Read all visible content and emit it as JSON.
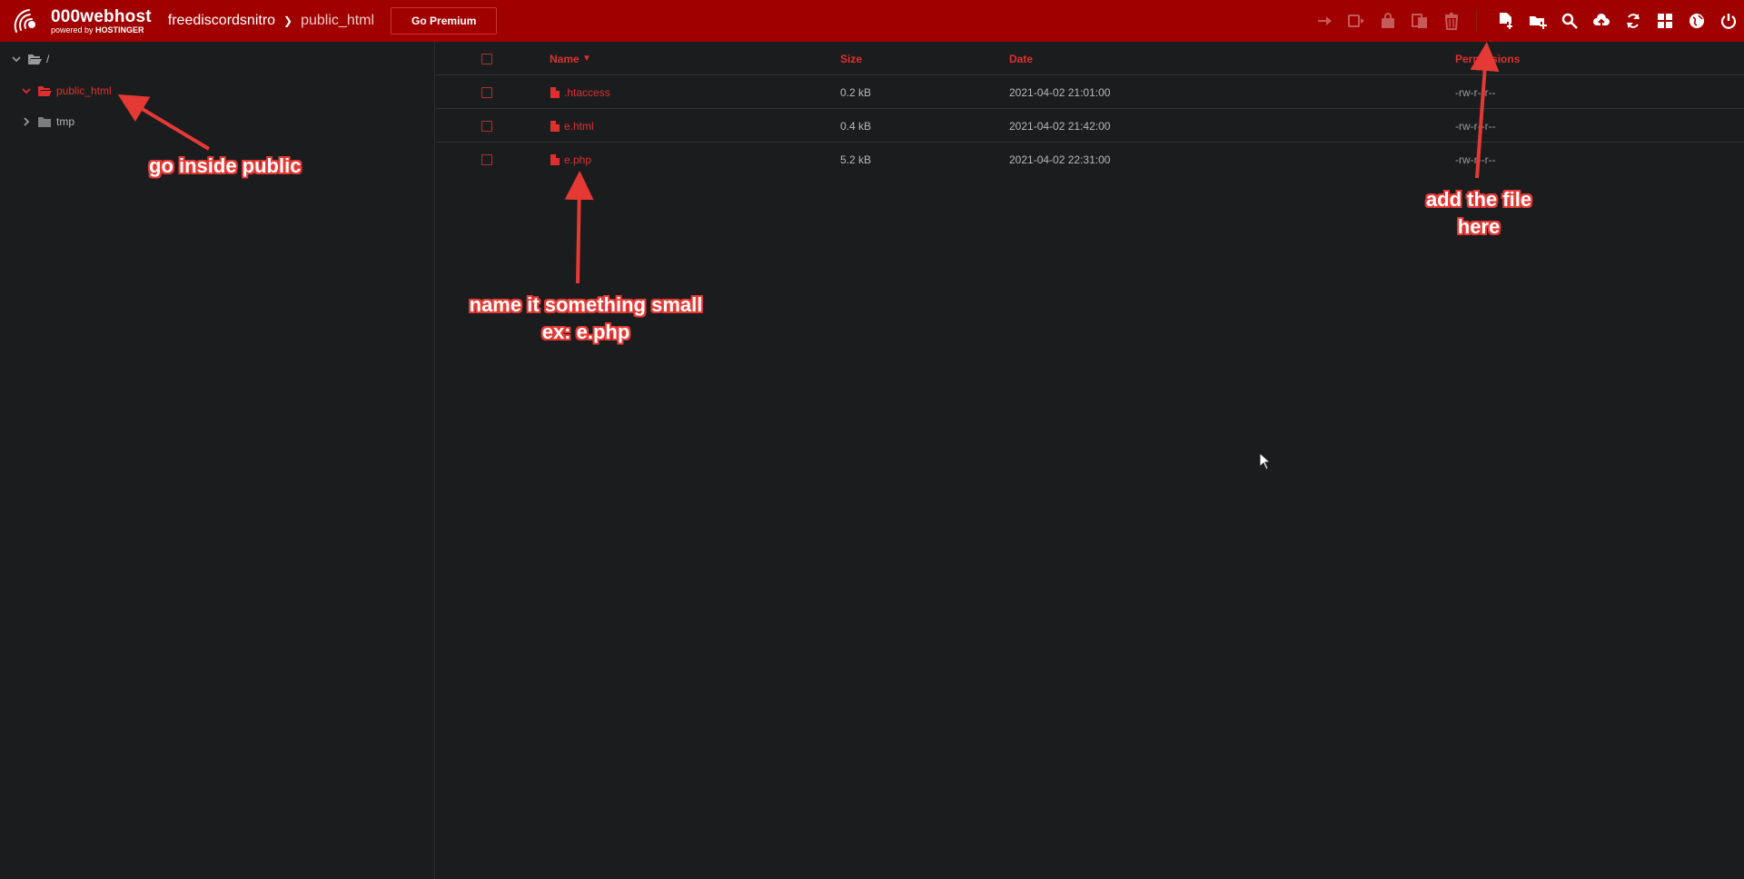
{
  "brand": {
    "name": "000webhost",
    "powered_by": "powered by",
    "company": "HOSTINGER"
  },
  "breadcrumb": {
    "site": "freediscordsnitro",
    "folder": "public_html"
  },
  "premium_button": "Go Premium",
  "toolbar": {
    "icons": [
      "move-icon",
      "rename-icon",
      "permissions-icon",
      "copy-icon",
      "delete-icon",
      "new-file-icon",
      "new-folder-icon",
      "search-icon",
      "upload-icon",
      "refresh-icon",
      "view-grid-icon",
      "website-icon",
      "power-icon"
    ]
  },
  "tree": {
    "root": "/",
    "items": [
      {
        "label": "public_html",
        "expanded": true,
        "active": true
      },
      {
        "label": "tmp",
        "expanded": false,
        "active": false
      }
    ]
  },
  "table": {
    "columns": {
      "name": "Name",
      "sort_indicator": "▼",
      "size": "Size",
      "date": "Date",
      "permissions": "Permissions"
    },
    "rows": [
      {
        "name": ".htaccess",
        "size": "0.2 kB",
        "date": "2021-04-02 21:01:00",
        "permissions": "-rw-r--r--"
      },
      {
        "name": "e.html",
        "size": "0.4 kB",
        "date": "2021-04-02 21:42:00",
        "permissions": "-rw-r--r--"
      },
      {
        "name": "e.php",
        "size": "5.2 kB",
        "date": "2021-04-02 22:31:00",
        "permissions": "-rw-r--r--"
      }
    ]
  },
  "annotations": {
    "go_inside": "go inside public",
    "name_it_line1": "name it something small",
    "name_it_line2": "ex: e.php",
    "add_file_line1": "add the file",
    "add_file_line2": "here"
  },
  "colors": {
    "topbar": "#a10000",
    "accent": "#e0302e",
    "background": "#1b1c1e",
    "annotation": "#e53935"
  }
}
